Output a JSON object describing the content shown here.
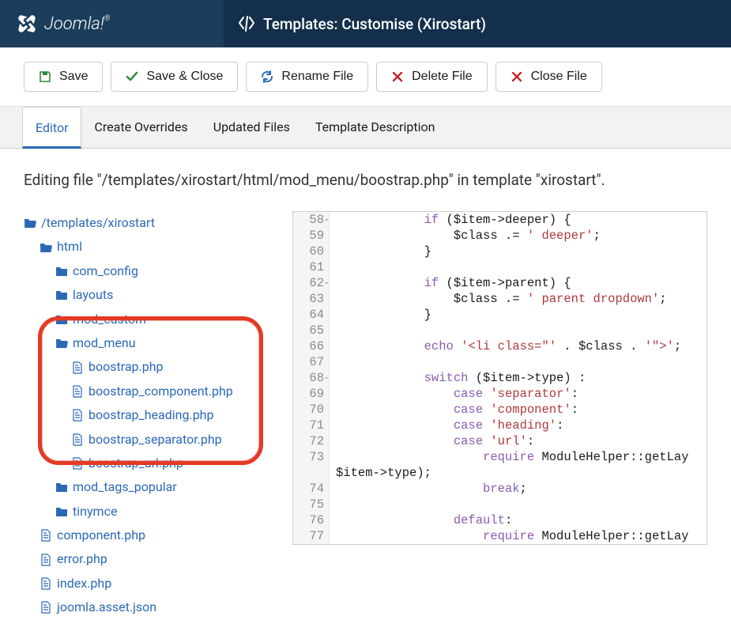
{
  "brand": {
    "name": "Joomla!"
  },
  "page_title": "Templates: Customise (Xirostart)",
  "toolbar": {
    "save": "Save",
    "save_close": "Save & Close",
    "rename": "Rename File",
    "delete": "Delete File",
    "close": "Close File"
  },
  "tabs": {
    "editor": "Editor",
    "overrides": "Create Overrides",
    "updated": "Updated Files",
    "description": "Template Description"
  },
  "editing_message": "Editing file \"/templates/xirostart/html/mod_menu/boostrap.php\" in template \"xirostart\".",
  "tree": {
    "root": "/templates/xirostart",
    "html": "html",
    "com_config": "com_config",
    "layouts": "layouts",
    "mod_custom": "mod_custom",
    "mod_menu": "mod_menu",
    "f_boostrap": "boostrap.php",
    "f_boostrap_component": "boostrap_component.php",
    "f_boostrap_heading": "boostrap_heading.php",
    "f_boostrap_separator": "boostrap_separator.php",
    "f_boostrap_url": "boostrap_url.php",
    "mod_tags_popular": "mod_tags_popular",
    "tinymce": "tinymce",
    "component_php": "component.php",
    "error_php": "error.php",
    "index_php": "index.php",
    "joomla_asset": "joomla.asset.json"
  },
  "code": {
    "lines": [
      {
        "n": 58,
        "fold": true,
        "html": "            <span class='tok-kw'>if</span> ($item-&gt;deeper) {"
      },
      {
        "n": 59,
        "fold": false,
        "html": "                $class .= <span class='tok-str'>' deeper'</span>;"
      },
      {
        "n": 60,
        "fold": false,
        "html": "            }"
      },
      {
        "n": 61,
        "fold": false,
        "html": ""
      },
      {
        "n": 62,
        "fold": true,
        "html": "            <span class='tok-kw'>if</span> ($item-&gt;parent) {"
      },
      {
        "n": 63,
        "fold": false,
        "html": "                $class .= <span class='tok-str'>' parent dropdown'</span>;"
      },
      {
        "n": 64,
        "fold": false,
        "html": "            }"
      },
      {
        "n": 65,
        "fold": false,
        "html": ""
      },
      {
        "n": 66,
        "fold": false,
        "html": "            <span class='tok-kw'>echo</span> <span class='tok-str'>'&lt;li class=\"'</span> . $class . <span class='tok-str'>'\"&gt;'</span>;"
      },
      {
        "n": 67,
        "fold": false,
        "html": ""
      },
      {
        "n": 68,
        "fold": true,
        "html": "            <span class='tok-kw'>switch</span> ($item-&gt;type) :"
      },
      {
        "n": 69,
        "fold": false,
        "html": "                <span class='tok-kw'>case</span> <span class='tok-str'>'separator'</span>:"
      },
      {
        "n": 70,
        "fold": false,
        "html": "                <span class='tok-kw'>case</span> <span class='tok-str'>'component'</span>:"
      },
      {
        "n": 71,
        "fold": false,
        "html": "                <span class='tok-kw'>case</span> <span class='tok-str'>'heading'</span>:"
      },
      {
        "n": 72,
        "fold": false,
        "html": "                <span class='tok-kw'>case</span> <span class='tok-str'>'url'</span>:"
      },
      {
        "n": 73,
        "fold": false,
        "html": "                    <span class='tok-kw'>require</span> ModuleHelper::getLay"
      },
      {
        "n": "",
        "fold": false,
        "html": "$item-&gt;type);"
      },
      {
        "n": 74,
        "fold": false,
        "html": "                    <span class='tok-kw'>break</span>;"
      },
      {
        "n": 75,
        "fold": false,
        "html": ""
      },
      {
        "n": 76,
        "fold": false,
        "html": "                <span class='tok-kw'>default</span>:"
      },
      {
        "n": 77,
        "fold": false,
        "html": "                    <span class='tok-kw'>require</span> ModuleHelper::getLay"
      }
    ]
  }
}
